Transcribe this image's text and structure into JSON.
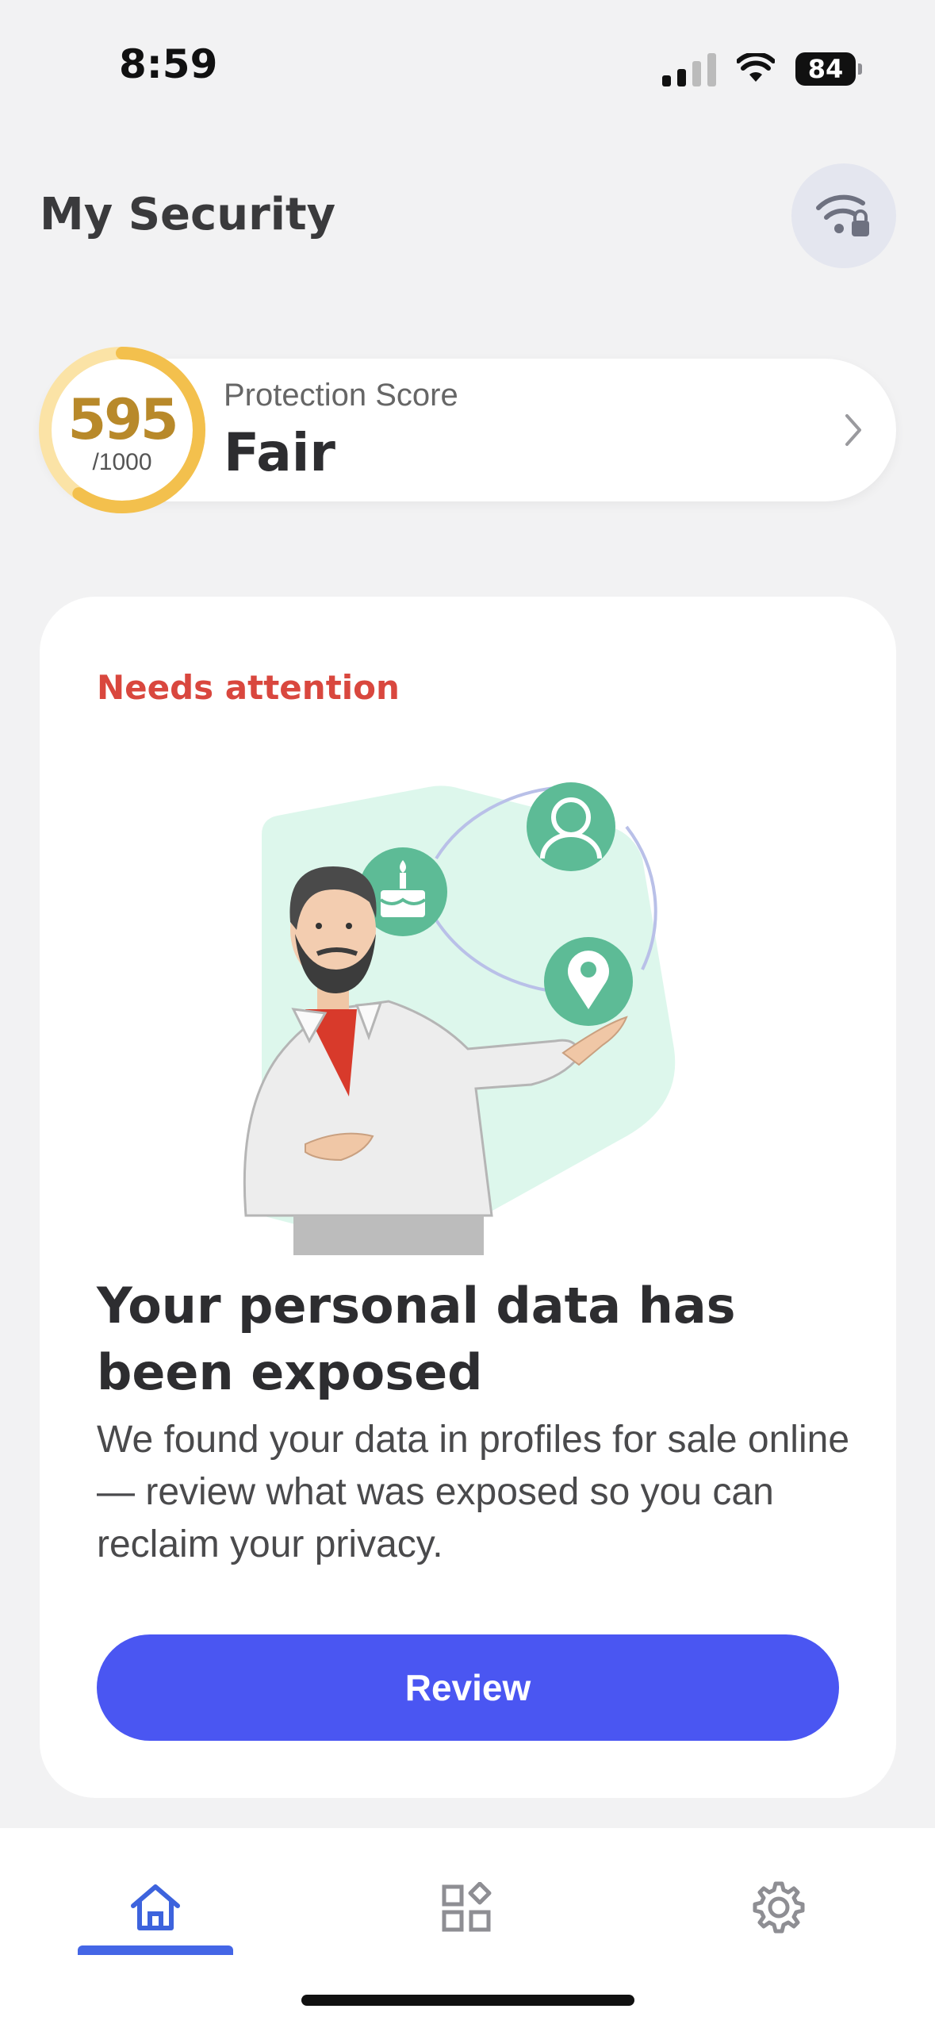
{
  "status_bar": {
    "time": "8:59",
    "battery": "84"
  },
  "header": {
    "title": "My Security",
    "action_icon": "wifi-lock-icon"
  },
  "score": {
    "value": "595",
    "max": "/1000",
    "fraction": 0.595,
    "label": "Protection Score",
    "status": "Fair",
    "color": "#f3c04d"
  },
  "attention_card": {
    "tag": "Needs attention",
    "heading": "Your personal data has been exposed",
    "body": "We found your data in profiles for sale online — review what was exposed so you can reclaim your privacy.",
    "button_label": "Review",
    "accent": "#4a56f2"
  },
  "nav": {
    "items": [
      {
        "icon": "home-icon",
        "active": true
      },
      {
        "icon": "apps-icon",
        "active": false
      },
      {
        "icon": "gear-icon",
        "active": false
      }
    ]
  }
}
